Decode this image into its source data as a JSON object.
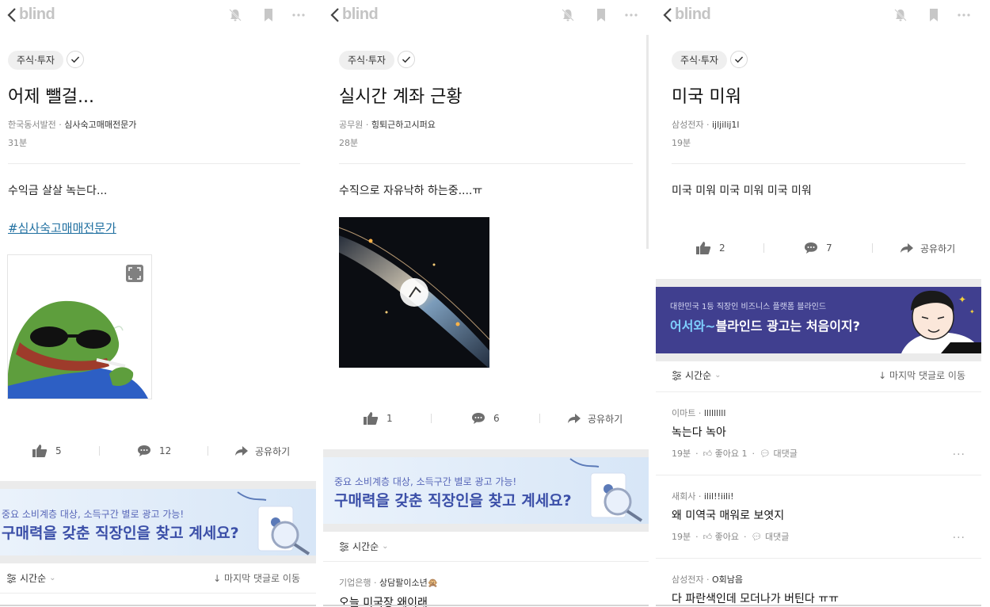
{
  "brand": {
    "logo": "blind"
  },
  "colors": {
    "ad_blue": "#3b4fa8",
    "ad_purple": "#403f8f",
    "link": "#1f6fa0"
  },
  "panels": [
    {
      "channel": "주식·투자",
      "title": "어제 뺄걸...",
      "company": "한국동서발전",
      "author": "심사숙고매매전문가",
      "time": "31분",
      "body": "수익금 살살 녹는다...",
      "hashtag": "#심사숙고매매전문가",
      "image": "pepe-smoking",
      "likes": "5",
      "comments": "12",
      "share": "공유하기",
      "ad": {
        "line1": "중요 소비계층 대상, 소득구간 별로 광고 가능!",
        "line2": "구매력을 갖춘 직장인을 찾고 계세요?"
      },
      "sort": {
        "label": "시간순",
        "jump": "마지막 댓글로 이동"
      }
    },
    {
      "channel": "주식·투자",
      "title": "실시간 계좌 근황",
      "company": "공무원",
      "author": "힝퇴근하고시퍼요",
      "time": "28분",
      "body": "수직으로 자유낙하 하는중....ㅠ",
      "image": "falling-figure-gif",
      "likes": "1",
      "comments": "6",
      "share": "공유하기",
      "ad": {
        "line1": "중요 소비계층 대상, 소득구간 별로 광고 가능!",
        "line2": "구매력을 갖춘 직장인을 찾고 계세요?"
      },
      "sort": {
        "label": "시간순"
      },
      "first_comment": {
        "company": "기업은행",
        "author": "상담팔이소년🙊",
        "text": "오늘 미국장 왜이래"
      }
    },
    {
      "channel": "주식·투자",
      "title": "미국 미워",
      "company": "삼성전자",
      "author": "ijljilij1l",
      "time": "19분",
      "body": "미국 미워 미국 미워 미국 미워",
      "likes": "2",
      "comments": "7",
      "share": "공유하기",
      "ad": {
        "line1": "대한민국 1등 직장인 비즈니스 플랫폼 블라인드",
        "line2a": "어서와~",
        "line2b": "블라인드 광고는 처음이지?"
      },
      "sort": {
        "label": "시간순",
        "jump": "마지막 댓글로 이동"
      },
      "comment_items": [
        {
          "company": "이마트",
          "author": "lllllllll",
          "text": "녹는다 녹아",
          "time": "19분",
          "like": "좋아요 1",
          "reply": "대댓글"
        },
        {
          "company": "새회사",
          "author": "ilil!!iili!",
          "text": "왜 미역국 매워로 보엿지",
          "time": "19분",
          "like": "좋아요",
          "reply": "대댓글"
        },
        {
          "company": "삼성전자",
          "author": "O회남음",
          "text": "다 파란색인데 모더나가 버틴다 ㅠㅠ"
        }
      ]
    }
  ]
}
